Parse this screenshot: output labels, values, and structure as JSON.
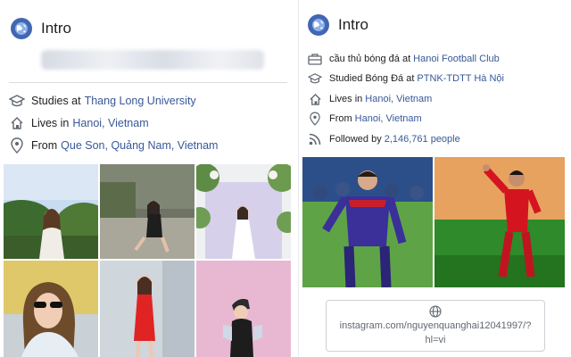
{
  "left": {
    "title": "Intro",
    "rows": [
      {
        "icon": "graduation-cap-icon",
        "prefix": "Studies at",
        "link": "Thang Long University"
      },
      {
        "icon": "house-icon",
        "prefix": "Lives in",
        "link": "Hanoi, Vietnam"
      },
      {
        "icon": "map-pin-icon",
        "prefix": "From",
        "link": "Que Son, Quảng Nam, Vietnam"
      }
    ]
  },
  "right": {
    "title": "Intro",
    "rows": [
      {
        "icon": "briefcase-icon",
        "prefix": "cầu thủ bóng đá at",
        "link": "Hanoi Football Club"
      },
      {
        "icon": "graduation-cap-icon",
        "prefix": "Studied Bóng Đá at",
        "link": "PTNK-TDTT Hà Nội"
      },
      {
        "icon": "house-icon",
        "prefix": "Lives in",
        "link": "Hanoi, Vietnam"
      },
      {
        "icon": "map-pin-icon",
        "prefix": "From",
        "link": "Hanoi, Vietnam"
      },
      {
        "icon": "rss-icon",
        "prefix": "Followed by",
        "link": "2,146,761 people"
      }
    ],
    "instagram": {
      "icon": "globe-icon",
      "url": "instagram.com/nguyenquanghai12041997/?hl=vi"
    }
  },
  "colors": {
    "link": "#385898",
    "accent": "#4267b2",
    "divider": "#dadde1"
  }
}
